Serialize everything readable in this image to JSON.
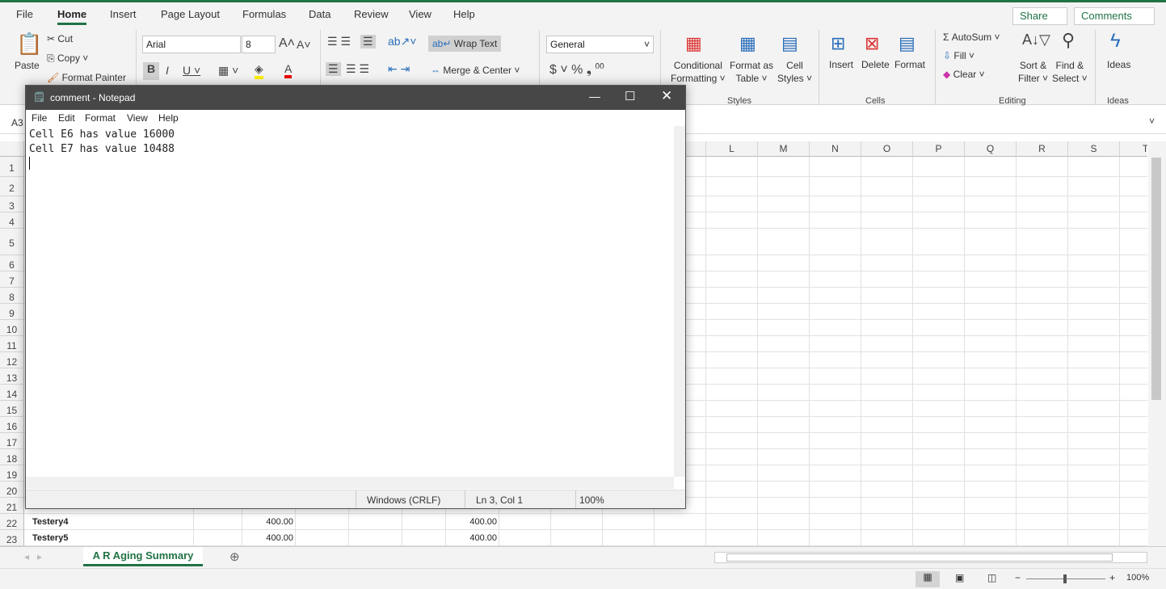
{
  "ribbon": {
    "tabs": [
      "File",
      "Home",
      "Insert",
      "Page Layout",
      "Formulas",
      "Data",
      "Review",
      "View",
      "Help"
    ],
    "share": "Share",
    "comments": "Comments",
    "paste": "Paste",
    "cut": "Cut",
    "copy": "Copy",
    "format_painter": "Format Painter",
    "font": "Arial",
    "font_size": "8",
    "wrap_text": "Wrap Text",
    "merge_center": "Merge & Center",
    "number_format": "General",
    "conditional_formatting": [
      "Conditional",
      "Formatting ˅"
    ],
    "format_as_table": [
      "Format as",
      "Table ˅"
    ],
    "cell_styles": [
      "Cell",
      "Styles ˅"
    ],
    "insert": "Insert",
    "delete": "Delete",
    "format": "Format",
    "autosum": "AutoSum",
    "fill": "Fill ˅",
    "clear": "Clear ˅",
    "sort_filter": [
      "Sort &",
      "Filter ˅"
    ],
    "find_select": [
      "Find &",
      "Select ˅"
    ],
    "ideas": "Ideas",
    "groups": {
      "styles": "Styles",
      "cells": "Cells",
      "editing": "Editing",
      "ideas": "Ideas"
    }
  },
  "name_box": "A3",
  "columns": [
    "L",
    "M",
    "N",
    "O",
    "P",
    "Q",
    "R",
    "S",
    "T"
  ],
  "rows": [
    "1",
    "2",
    "3",
    "4",
    "5",
    "6",
    "7",
    "8",
    "9",
    "10",
    "11",
    "12",
    "13",
    "14",
    "15",
    "16",
    "17",
    "18",
    "19",
    "20",
    "21",
    "22",
    "23"
  ],
  "cells": [
    {
      "row": "22",
      "name": "Testery4",
      "c": "400.00",
      "g": "400.00"
    },
    {
      "row": "23",
      "name": "Testery5",
      "c": "400.00",
      "g": "400.00"
    }
  ],
  "sheet_tab": "A R Aging Summary",
  "zoom": "100%",
  "notepad": {
    "title": "comment - Notepad",
    "menu": [
      "File",
      "Edit",
      "Format",
      "View",
      "Help"
    ],
    "lines": [
      "Cell E6 has value 16000",
      "Cell E7 has value 10488"
    ],
    "encoding": "Windows (CRLF)",
    "position": "Ln 3, Col 1",
    "zoom": "100%"
  }
}
